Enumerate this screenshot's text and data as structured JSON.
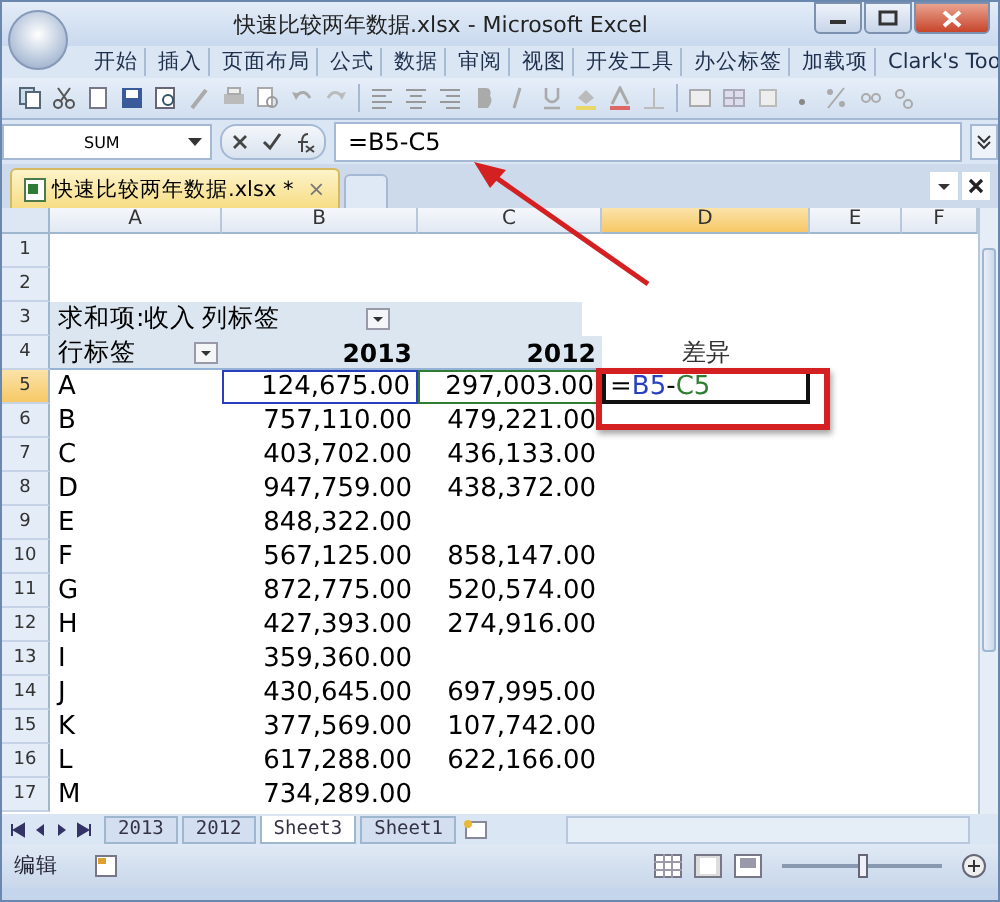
{
  "window": {
    "title": "快速比较两年数据.xlsx - Microsoft Excel"
  },
  "ribbon_tabs": [
    "开始",
    "插入",
    "页面布局",
    "公式",
    "数据",
    "审阅",
    "视图",
    "开发工具",
    "办公标签",
    "加载项",
    "Clark's Too"
  ],
  "name_box": "SUM",
  "formula": "=B5-C5",
  "document_tab": {
    "title": "快速比较两年数据.xlsx *",
    "close": "×"
  },
  "columns": [
    {
      "label": "A",
      "selected": false
    },
    {
      "label": "B",
      "selected": false
    },
    {
      "label": "C",
      "selected": false
    },
    {
      "label": "D",
      "selected": true
    },
    {
      "label": "E",
      "selected": false
    },
    {
      "label": "F",
      "selected": false
    }
  ],
  "rows": [
    {
      "num": "1",
      "selected": false,
      "cells": [
        "",
        "",
        "",
        ""
      ]
    },
    {
      "num": "2",
      "selected": false,
      "cells": [
        "",
        "",
        "",
        ""
      ]
    },
    {
      "num": "3",
      "selected": false,
      "kind": "pivot-header",
      "cells": [
        "求和项:收入",
        "列标签",
        "",
        ""
      ]
    },
    {
      "num": "4",
      "selected": false,
      "kind": "pivot-columns",
      "cells": [
        "行标签",
        "2013",
        "2012",
        "差异"
      ]
    },
    {
      "num": "5",
      "selected": true,
      "cells": [
        "A",
        "124,675.00",
        "297,003.00",
        ""
      ]
    },
    {
      "num": "6",
      "selected": false,
      "cells": [
        "B",
        "757,110.00",
        "479,221.00",
        ""
      ]
    },
    {
      "num": "7",
      "selected": false,
      "cells": [
        "C",
        "403,702.00",
        "436,133.00",
        ""
      ]
    },
    {
      "num": "8",
      "selected": false,
      "cells": [
        "D",
        "947,759.00",
        "438,372.00",
        ""
      ]
    },
    {
      "num": "9",
      "selected": false,
      "cells": [
        "E",
        "848,322.00",
        "",
        ""
      ]
    },
    {
      "num": "10",
      "selected": false,
      "cells": [
        "F",
        "567,125.00",
        "858,147.00",
        ""
      ]
    },
    {
      "num": "11",
      "selected": false,
      "cells": [
        "G",
        "872,775.00",
        "520,574.00",
        ""
      ]
    },
    {
      "num": "12",
      "selected": false,
      "cells": [
        "H",
        "427,393.00",
        "274,916.00",
        ""
      ]
    },
    {
      "num": "13",
      "selected": false,
      "cells": [
        "I",
        "359,360.00",
        "",
        ""
      ]
    },
    {
      "num": "14",
      "selected": false,
      "cells": [
        "J",
        "430,645.00",
        "697,995.00",
        ""
      ]
    },
    {
      "num": "15",
      "selected": false,
      "cells": [
        "K",
        "377,569.00",
        "107,742.00",
        ""
      ]
    },
    {
      "num": "16",
      "selected": false,
      "cells": [
        "L",
        "617,288.00",
        "622,166.00",
        ""
      ]
    },
    {
      "num": "17",
      "selected": false,
      "cells": [
        "M",
        "734,289.00",
        "",
        ""
      ]
    }
  ],
  "editing_cell": [
    {
      "text": "=",
      "color": "#000000"
    },
    {
      "text": "B5",
      "color": "#2a3fbf"
    },
    {
      "text": "-",
      "color": "#000000"
    },
    {
      "text": "C5",
      "color": "#2e7d32"
    }
  ],
  "sheet_tabs": [
    {
      "label": "2013",
      "selected": false
    },
    {
      "label": "2012",
      "selected": false
    },
    {
      "label": "Sheet3",
      "selected": true
    },
    {
      "label": "Sheet1",
      "selected": false
    }
  ],
  "status_bar": {
    "mode": "编辑",
    "zoom_slider": {
      "level": 0.5
    }
  }
}
